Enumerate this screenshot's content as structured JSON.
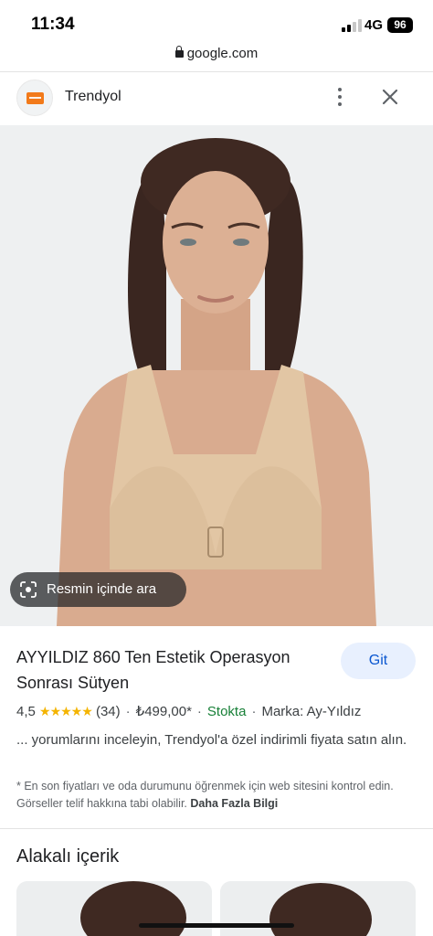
{
  "status_bar": {
    "time": "11:34",
    "network": "4G",
    "battery": "96"
  },
  "browser": {
    "url": "google.com"
  },
  "site": {
    "name": "Trendyol"
  },
  "image": {
    "lens_label": "Resmin içinde ara"
  },
  "product": {
    "title": "AYYILDIZ 860 Ten Estetik Operasyon Sonrası Sütyen",
    "go_label": "Git",
    "rating": "4,5",
    "stars": "★★★★★",
    "reviews": "(34)",
    "price": "₺499,00*",
    "stock": "Stokta",
    "brand": "Marka: Ay-Yıldız",
    "snippet": "... yorumlarını inceleyin, Trendyol'a özel indirimli fiyata satın alın.",
    "disclaimer": "* En son fiyatları ve oda durumunu öğrenmek için web sitesini kontrol edin. Görseller telif hakkına tabi olabilir.",
    "more_info": "Daha Fazla Bilgi"
  },
  "related": {
    "title": "Alakalı içerik"
  },
  "colors": {
    "accent": "#0b57d0",
    "accent_bg": "#e8f0fe",
    "stock_green": "#188038",
    "star": "#f4b400",
    "brand": "#f27a1a"
  }
}
